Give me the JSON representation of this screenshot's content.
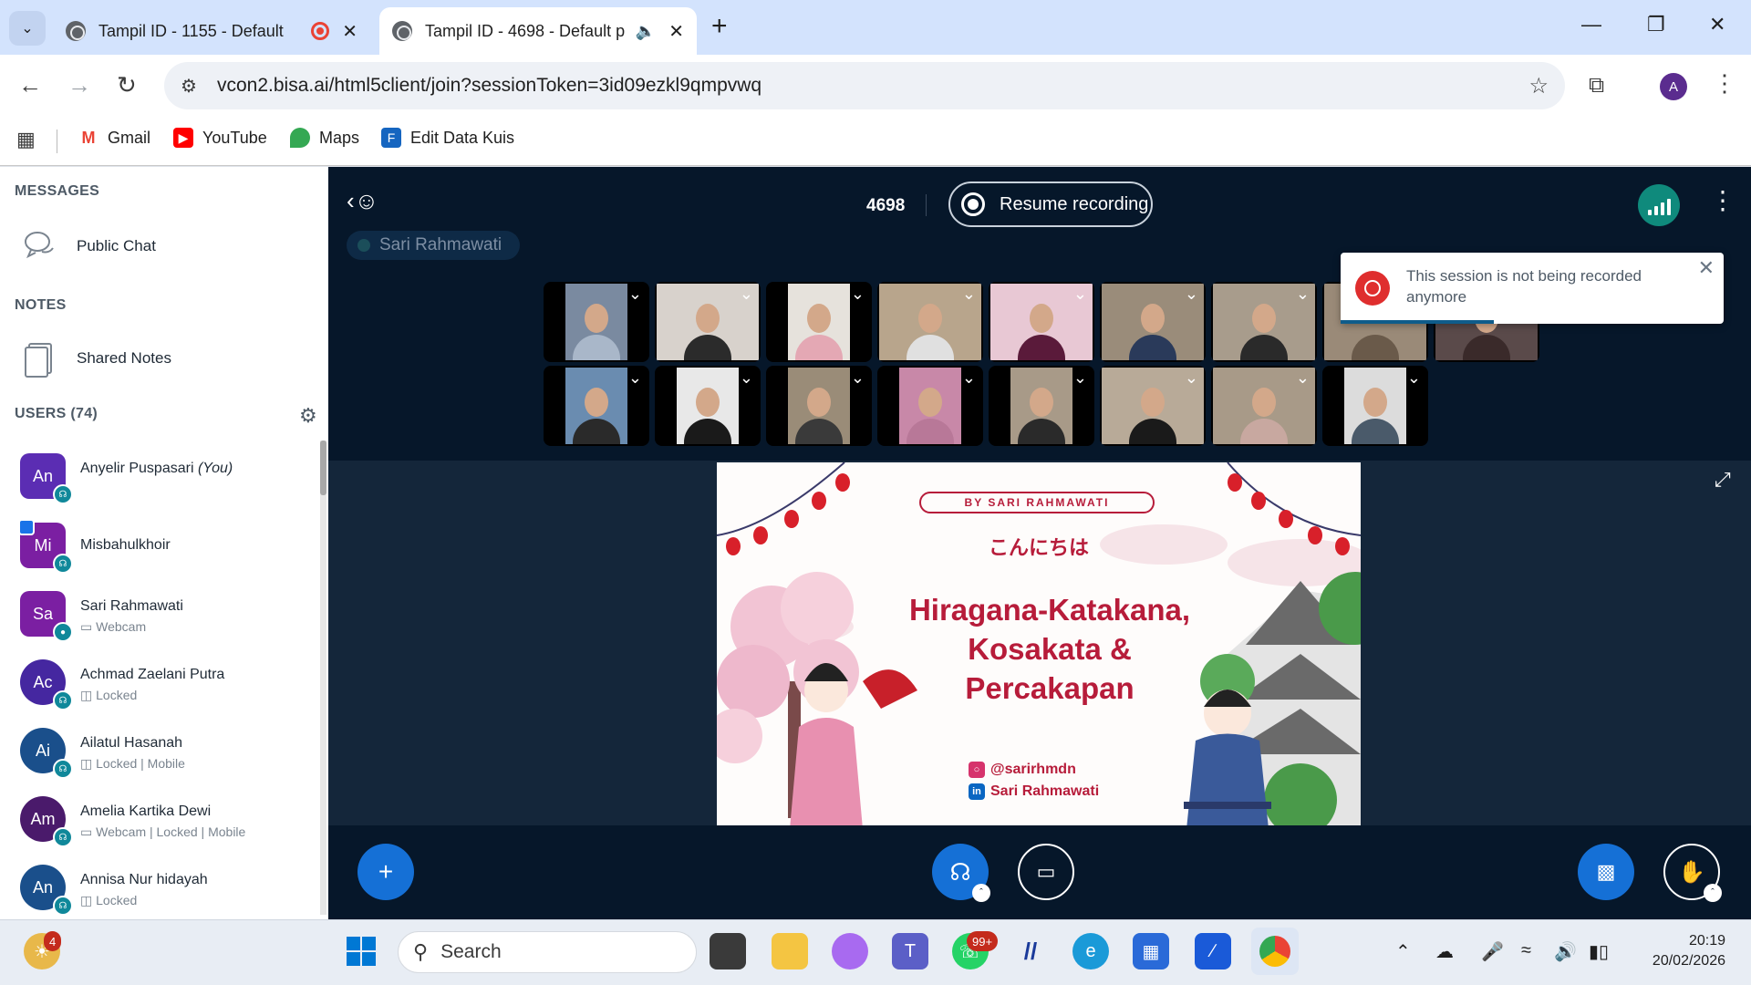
{
  "browser": {
    "tabs": [
      {
        "title": "Tampil ID - 1155 - Default",
        "active": false
      },
      {
        "title": "Tampil ID - 4698 - Default p",
        "active": true
      }
    ],
    "url": "vcon2.bisa.ai/html5client/join?sessionToken=3id09ezkl9qmpvwq",
    "profile_initial": "A",
    "bookmarks": [
      "Gmail",
      "YouTube",
      "Maps",
      "Edit Data Kuis"
    ]
  },
  "sidebar": {
    "messages_title": "MESSAGES",
    "public_chat": "Public Chat",
    "notes_title": "NOTES",
    "shared_notes": "Shared Notes",
    "users_title": "USERS (74)",
    "users": [
      {
        "initials": "An",
        "name": "Anyelir Puspasari",
        "you": "(You)",
        "sub": "",
        "color": "#5b2db3"
      },
      {
        "initials": "Mi",
        "name": "Misbahulkhoir",
        "sub": "",
        "color": "#7b1fa2"
      },
      {
        "initials": "Sa",
        "name": "Sari Rahmawati",
        "sub": "Webcam",
        "color": "#7b1fa2"
      },
      {
        "initials": "Ac",
        "name": "Achmad Zaelani Putra",
        "sub": "Locked",
        "color": "#4527a0"
      },
      {
        "initials": "Ai",
        "name": "Ailatul Hasanah",
        "sub": "Locked | Mobile",
        "color": "#1a4f8b"
      },
      {
        "initials": "Am",
        "name": "Amelia Kartika Dewi",
        "sub": "Webcam | Locked | Mobile",
        "color": "#4a1a6b"
      },
      {
        "initials": "An",
        "name": "Annisa Nur hidayah",
        "sub": "Locked",
        "color": "#1a4f8b"
      }
    ]
  },
  "meeting": {
    "id": "4698",
    "record_label": "Resume recording",
    "talking": "Sari Rahmawati",
    "toast": "This session is not being recorded anymore"
  },
  "slide": {
    "by": "BY SARI RAHMAWATI",
    "greeting": "こんにちは",
    "title_lines": [
      "Hiragana-Katakana,",
      "Kosakata &",
      "Percakapan"
    ],
    "instagram": "@sarirhmdn",
    "linkedin": "Sari Rahmawati"
  },
  "taskbar": {
    "search": "Search",
    "notif_badge": "4",
    "whatsapp_badge": "99+",
    "time": "20:19",
    "date": "20/02/2026"
  }
}
